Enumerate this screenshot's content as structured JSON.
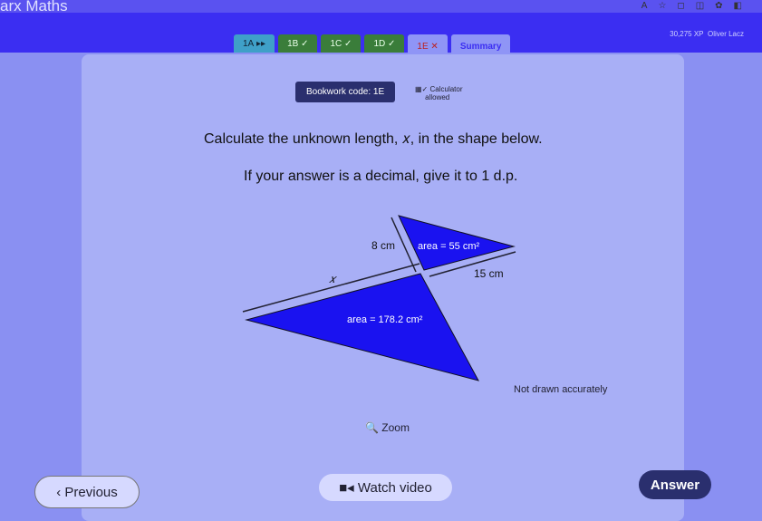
{
  "app": {
    "brand": "arx Maths",
    "xp": "30,275 XP",
    "user": "Oliver Lacz"
  },
  "tabs": [
    {
      "label": "1A",
      "status": "▸▸"
    },
    {
      "label": "1B",
      "status": "✓"
    },
    {
      "label": "1C",
      "status": "✓"
    },
    {
      "label": "1D",
      "status": "✓"
    },
    {
      "label": "1E",
      "status": "✕"
    },
    {
      "label": "Summary",
      "status": ""
    }
  ],
  "bookwork": "Bookwork code: 1E",
  "calculator": {
    "line1": "Calculator",
    "line2": "allowed"
  },
  "question": {
    "line1": "Calculate the unknown length, 𝑥, in the shape below.",
    "line2": "If your answer is a decimal, give it to 1 d.p."
  },
  "diagram": {
    "label_8": "8 cm",
    "label_15": "15 cm",
    "label_x": "𝑥",
    "area_small": "area = 55 cm²",
    "area_large": "area = 178.2 cm²",
    "note": "Not drawn accurately",
    "fill": "#1a12f0"
  },
  "buttons": {
    "zoom": "Zoom",
    "previous": "Previous",
    "video": "Watch video",
    "answer": "Answer"
  }
}
